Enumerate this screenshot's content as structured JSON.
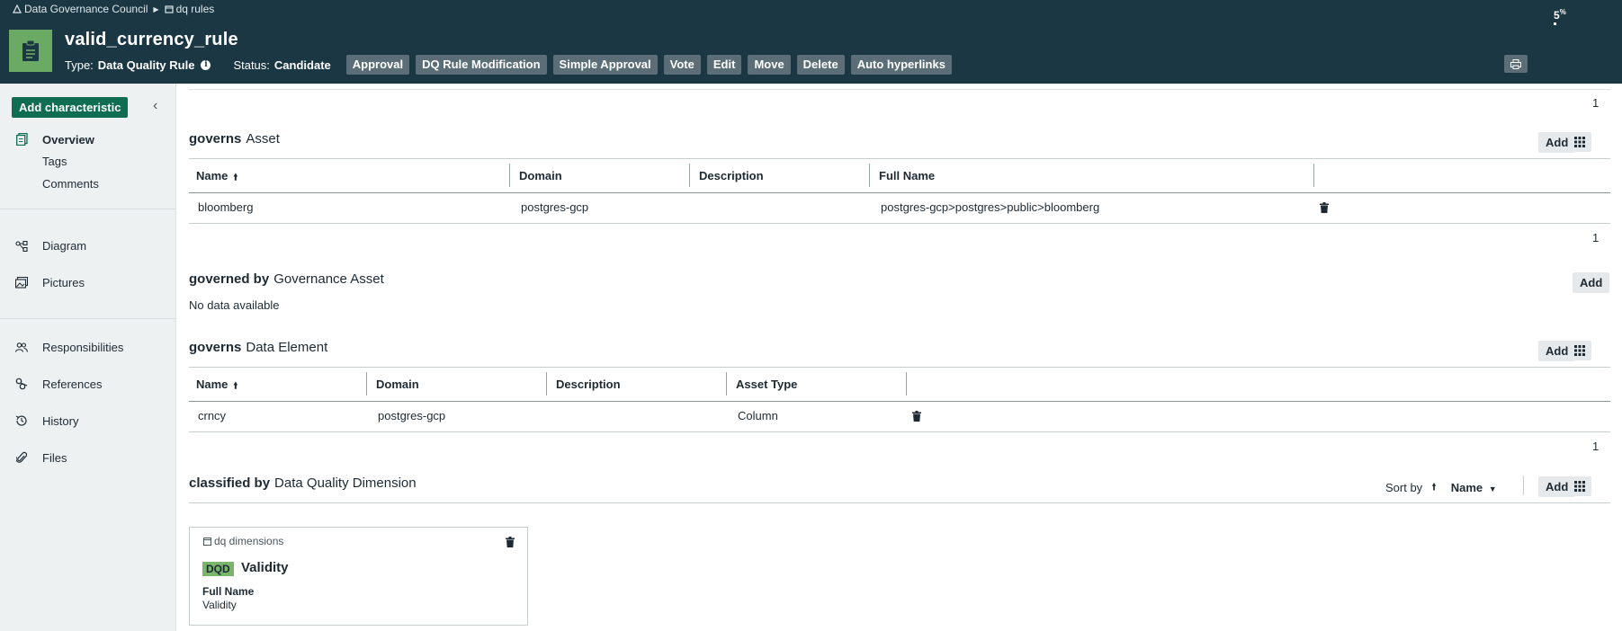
{
  "breadcrumb": {
    "community": "Data Governance Council",
    "domain": "dq rules"
  },
  "header": {
    "title": "valid_currency_rule",
    "type_label": "Type:",
    "type_value": "Data Quality Rule",
    "status_label": "Status:",
    "status_value": "Candidate",
    "actions": [
      "Approval",
      "DQ Rule Modification",
      "Simple Approval",
      "Vote",
      "Edit",
      "Move",
      "Delete",
      "Auto hyperlinks"
    ],
    "progress_value": "5",
    "progress_unit": "%"
  },
  "sidebar": {
    "add_characteristic": "Add characteristic",
    "items": {
      "overview": "Overview",
      "tags": "Tags",
      "comments": "Comments",
      "diagram": "Diagram",
      "pictures": "Pictures",
      "responsibilities": "Responsibilities",
      "references": "References",
      "history": "History",
      "files": "Files"
    }
  },
  "main": {
    "top_page": "1",
    "governs_asset": {
      "verb": "governs",
      "target": "Asset",
      "add": "Add",
      "columns": [
        "Name",
        "Domain",
        "Description",
        "Full Name"
      ],
      "rows": [
        {
          "name": "bloomberg",
          "domain": "postgres-gcp",
          "description": "",
          "full_name": "postgres-gcp>postgres>public>bloomberg"
        }
      ],
      "page": "1"
    },
    "governed_by": {
      "verb": "governed by",
      "target": "Governance Asset",
      "add": "Add",
      "empty": "No data available"
    },
    "governs_element": {
      "verb": "governs",
      "target": "Data Element",
      "add": "Add",
      "columns": [
        "Name",
        "Domain",
        "Description",
        "Asset Type"
      ],
      "rows": [
        {
          "name": "crncy",
          "domain": "postgres-gcp",
          "description": "",
          "asset_type": "Column"
        }
      ],
      "page": "1"
    },
    "classified_by": {
      "verb": "classified by",
      "target": "Data Quality Dimension",
      "sort_label": "Sort by",
      "sort_field": "Name",
      "add": "Add",
      "card": {
        "domain": "dq dimensions",
        "badge": "DQD",
        "name": "Validity",
        "field_label": "Full Name",
        "field_value": "Validity"
      }
    }
  },
  "colors": {
    "header_bg": "#1b3743",
    "accent_green": "#0f6e52",
    "asset_icon": "#6aaa64",
    "badge": "#79b66b"
  }
}
